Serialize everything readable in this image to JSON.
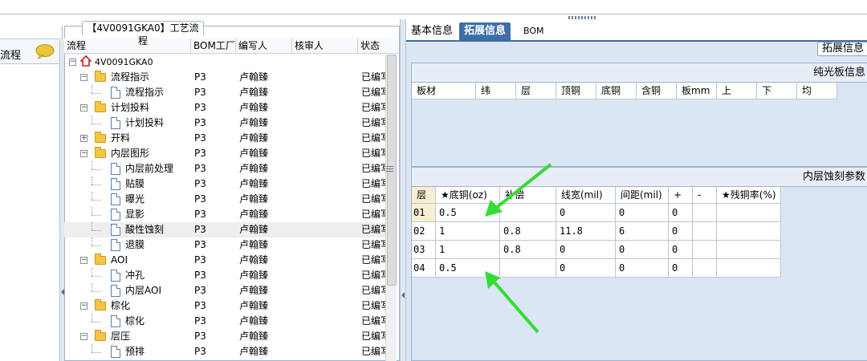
{
  "left_panel": {
    "title": "流程"
  },
  "tree_tab": {
    "label": "【4V0091GKA0】工艺流程"
  },
  "tree_columns": [
    "流程",
    "BOM工厂",
    "编写人",
    "核审人",
    "状态"
  ],
  "tree_rows": [
    {
      "name": "4V0091GKA0",
      "level": 0,
      "kind": "root",
      "bom": "",
      "writer": "",
      "reviewer": "",
      "status": ""
    },
    {
      "name": "流程指示",
      "level": 1,
      "kind": "folder",
      "bom": "P3",
      "writer": "卢翰臻",
      "reviewer": "",
      "status": "已编写"
    },
    {
      "name": "流程指示",
      "level": 2,
      "kind": "doc",
      "bom": "P3",
      "writer": "卢翰臻",
      "reviewer": "",
      "status": "已编写"
    },
    {
      "name": "计划投料",
      "level": 1,
      "kind": "folder",
      "bom": "P3",
      "writer": "卢翰臻",
      "reviewer": "",
      "status": "已编写"
    },
    {
      "name": "计划投料",
      "level": 2,
      "kind": "doc",
      "bom": "P3",
      "writer": "卢翰臻",
      "reviewer": "",
      "status": "已编写"
    },
    {
      "name": "开料",
      "level": 1,
      "kind": "folder-collapsed",
      "bom": "P3",
      "writer": "卢翰臻",
      "reviewer": "",
      "status": "已编写"
    },
    {
      "name": "内层图形",
      "level": 1,
      "kind": "folder",
      "bom": "P3",
      "writer": "卢翰臻",
      "reviewer": "",
      "status": "已编写"
    },
    {
      "name": "内层前处理",
      "level": 2,
      "kind": "doc",
      "bom": "P3",
      "writer": "卢翰臻",
      "reviewer": "",
      "status": "已编写"
    },
    {
      "name": "贴膜",
      "level": 2,
      "kind": "doc",
      "bom": "P3",
      "writer": "卢翰臻",
      "reviewer": "",
      "status": "已编写"
    },
    {
      "name": "曝光",
      "level": 2,
      "kind": "doc",
      "bom": "P3",
      "writer": "卢翰臻",
      "reviewer": "",
      "status": "已编写"
    },
    {
      "name": "显影",
      "level": 2,
      "kind": "doc",
      "bom": "P3",
      "writer": "卢翰臻",
      "reviewer": "",
      "status": "已编写"
    },
    {
      "name": "酸性蚀刻",
      "level": 2,
      "kind": "doc",
      "bom": "P3",
      "writer": "卢翰臻",
      "reviewer": "",
      "status": "已编写",
      "selected": true
    },
    {
      "name": "退膜",
      "level": 2,
      "kind": "doc",
      "bom": "P3",
      "writer": "卢翰臻",
      "reviewer": "",
      "status": "已编写"
    },
    {
      "name": "AOI",
      "level": 1,
      "kind": "folder",
      "bom": "P3",
      "writer": "卢翰臻",
      "reviewer": "",
      "status": "已编写"
    },
    {
      "name": "冲孔",
      "level": 2,
      "kind": "doc",
      "bom": "P3",
      "writer": "卢翰臻",
      "reviewer": "",
      "status": "已编写"
    },
    {
      "name": "内层AOI",
      "level": 2,
      "kind": "doc",
      "bom": "P3",
      "writer": "卢翰臻",
      "reviewer": "",
      "status": "已编写"
    },
    {
      "name": "棕化",
      "level": 1,
      "kind": "folder",
      "bom": "P3",
      "writer": "卢翰臻",
      "reviewer": "",
      "status": "已编写"
    },
    {
      "name": "棕化",
      "level": 2,
      "kind": "doc",
      "bom": "P3",
      "writer": "卢翰臻",
      "reviewer": "",
      "status": "已编写"
    },
    {
      "name": "层压",
      "level": 1,
      "kind": "folder",
      "bom": "P3",
      "writer": "卢翰臻",
      "reviewer": "",
      "status": "已编写"
    },
    {
      "name": "预排",
      "level": 2,
      "kind": "doc",
      "bom": "P3",
      "writer": "卢翰臻",
      "reviewer": "",
      "status": "已编写"
    }
  ],
  "tabs": [
    {
      "label": "基本信息",
      "active": false
    },
    {
      "label": "拓展信息",
      "active": true
    },
    {
      "label": "BOM",
      "active": false
    }
  ],
  "ext_button": {
    "label": "拓展信息"
  },
  "panel1": {
    "title": "纯光板信息",
    "columns": [
      "板材",
      "纬",
      "层",
      "顶铜",
      "底铜",
      "含铜",
      "板mm",
      "上",
      "下",
      "均"
    ]
  },
  "panel2": {
    "title": "内层蚀刻参数",
    "columns": [
      "层",
      "★底铜(oz)",
      "补偿",
      "线宽(mil)",
      "间距(mil)",
      "+",
      "-",
      "★残铜率(%)"
    ],
    "rows": [
      [
        "01",
        "0.5",
        "",
        "0",
        "0",
        "0",
        "",
        ""
      ],
      [
        "02",
        "1",
        "0.8",
        "11.8",
        "6",
        "0",
        "",
        ""
      ],
      [
        "03",
        "1",
        "0.8",
        "0",
        "0",
        "0",
        "",
        ""
      ],
      [
        "04",
        "0.5",
        "",
        "0",
        "0",
        "0",
        "",
        ""
      ]
    ]
  },
  "colors": {
    "accent": "#3d6ea8",
    "panel_bg": "#dbe6f4",
    "annotation_arrow": "#33dd33"
  }
}
